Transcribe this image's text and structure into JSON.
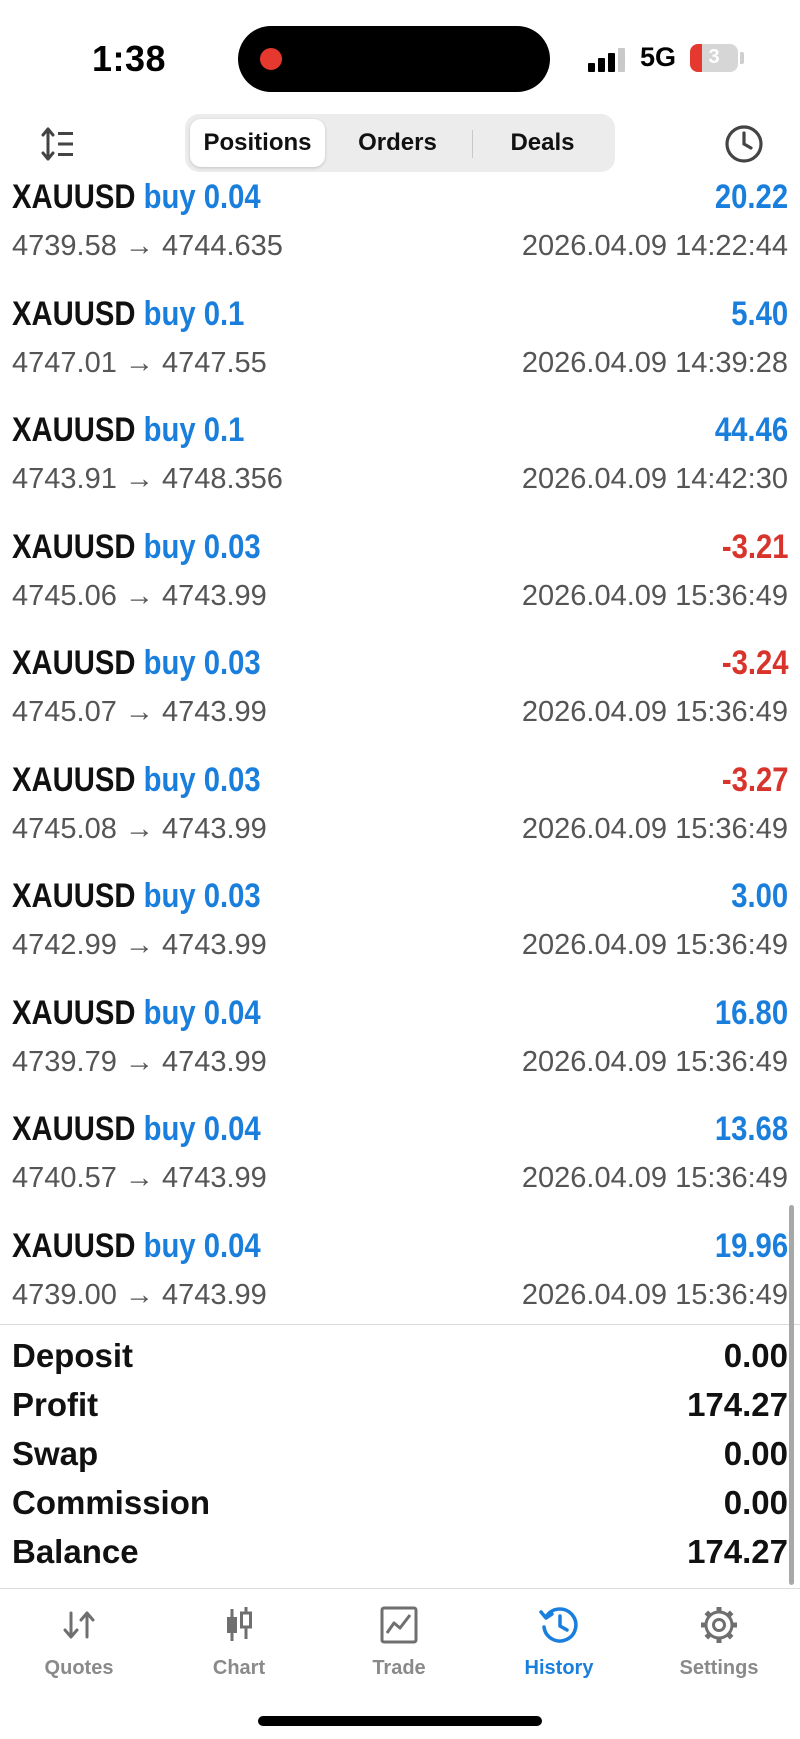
{
  "status_bar": {
    "time": "1:38",
    "network": "5G",
    "battery": "3"
  },
  "toolbar": {
    "tabs": [
      {
        "label": "Positions",
        "active": true
      },
      {
        "label": "Orders",
        "active": false
      },
      {
        "label": "Deals",
        "active": false
      }
    ]
  },
  "deals": [
    {
      "symbol": "XAUUSD",
      "side": "buy",
      "volume": "0.04",
      "prices": "4739.58 → 4744.635",
      "time": "2026.04.09 14:22:44",
      "profit": "20.22",
      "negative": false
    },
    {
      "symbol": "XAUUSD",
      "side": "buy",
      "volume": "0.1",
      "prices": "4747.01 → 4747.55",
      "time": "2026.04.09 14:39:28",
      "profit": "5.40",
      "negative": false
    },
    {
      "symbol": "XAUUSD",
      "side": "buy",
      "volume": "0.1",
      "prices": "4743.91 → 4748.356",
      "time": "2026.04.09 14:42:30",
      "profit": "44.46",
      "negative": false
    },
    {
      "symbol": "XAUUSD",
      "side": "buy",
      "volume": "0.03",
      "prices": "4745.06 → 4743.99",
      "time": "2026.04.09 15:36:49",
      "profit": "-3.21",
      "negative": true
    },
    {
      "symbol": "XAUUSD",
      "side": "buy",
      "volume": "0.03",
      "prices": "4745.07 → 4743.99",
      "time": "2026.04.09 15:36:49",
      "profit": "-3.24",
      "negative": true
    },
    {
      "symbol": "XAUUSD",
      "side": "buy",
      "volume": "0.03",
      "prices": "4745.08 → 4743.99",
      "time": "2026.04.09 15:36:49",
      "profit": "-3.27",
      "negative": true
    },
    {
      "symbol": "XAUUSD",
      "side": "buy",
      "volume": "0.03",
      "prices": "4742.99 → 4743.99",
      "time": "2026.04.09 15:36:49",
      "profit": "3.00",
      "negative": false
    },
    {
      "symbol": "XAUUSD",
      "side": "buy",
      "volume": "0.04",
      "prices": "4739.79 → 4743.99",
      "time": "2026.04.09 15:36:49",
      "profit": "16.80",
      "negative": false
    },
    {
      "symbol": "XAUUSD",
      "side": "buy",
      "volume": "0.04",
      "prices": "4740.57 → 4743.99",
      "time": "2026.04.09 15:36:49",
      "profit": "13.68",
      "negative": false
    },
    {
      "symbol": "XAUUSD",
      "side": "buy",
      "volume": "0.04",
      "prices": "4739.00 → 4743.99",
      "time": "2026.04.09 15:36:49",
      "profit": "19.96",
      "negative": false
    }
  ],
  "summary": [
    {
      "label": "Deposit",
      "value": "0.00"
    },
    {
      "label": "Profit",
      "value": "174.27"
    },
    {
      "label": "Swap",
      "value": "0.00"
    },
    {
      "label": "Commission",
      "value": "0.00"
    },
    {
      "label": "Balance",
      "value": "174.27"
    }
  ],
  "tabbar": [
    {
      "label": "Quotes",
      "icon": "quotes-icon",
      "active": false
    },
    {
      "label": "Chart",
      "icon": "chart-icon",
      "active": false
    },
    {
      "label": "Trade",
      "icon": "trade-icon",
      "active": false
    },
    {
      "label": "History",
      "icon": "history-icon",
      "active": true
    },
    {
      "label": "Settings",
      "icon": "settings-icon",
      "active": false
    }
  ],
  "colors": {
    "accent": "#1a7fdc",
    "negative": "#d9342b",
    "inactive": "#8a8a8a"
  }
}
